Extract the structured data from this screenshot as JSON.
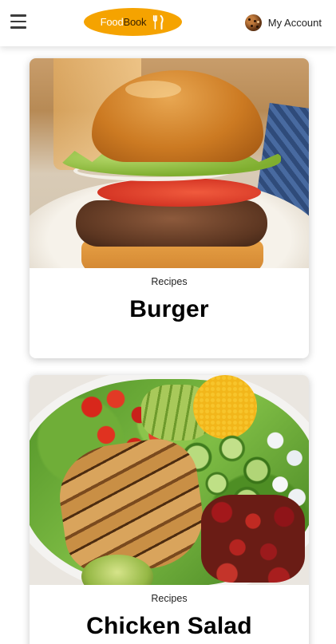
{
  "header": {
    "logo_food": "Food",
    "logo_book": "Book",
    "account_label": "My Account",
    "brand_color": "#f5a300"
  },
  "cards": [
    {
      "category": "Recipes",
      "title": "Burger"
    },
    {
      "category": "Recipes",
      "title": "Chicken Salad"
    }
  ]
}
